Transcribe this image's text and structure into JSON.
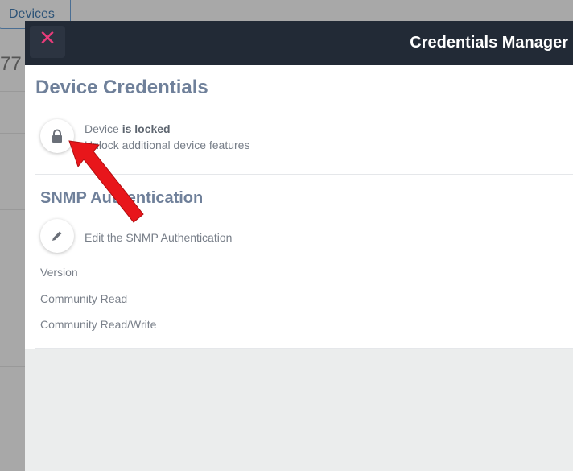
{
  "background": {
    "tab_label": "Devices",
    "partial_number": "77"
  },
  "modal": {
    "title": "Credentials Manager",
    "close_glyph": "✕",
    "device_credentials": {
      "heading": "Device Credentials",
      "lock_prefix": "Device",
      "lock_status": "is locked",
      "lock_subtitle": "Unlock additional device features",
      "lock_icon": "lock-icon"
    },
    "snmp": {
      "heading": "SNMP Authentication",
      "edit_label": "Edit the SNMP Authentication",
      "edit_icon": "pencil-icon",
      "fields": [
        "Version",
        "Community Read",
        "Community Read/Write"
      ]
    }
  },
  "colors": {
    "header_bg": "#222a36",
    "close_accent": "#e83c7a",
    "heading": "#6f809a",
    "annotation_arrow": "#e8161b"
  }
}
